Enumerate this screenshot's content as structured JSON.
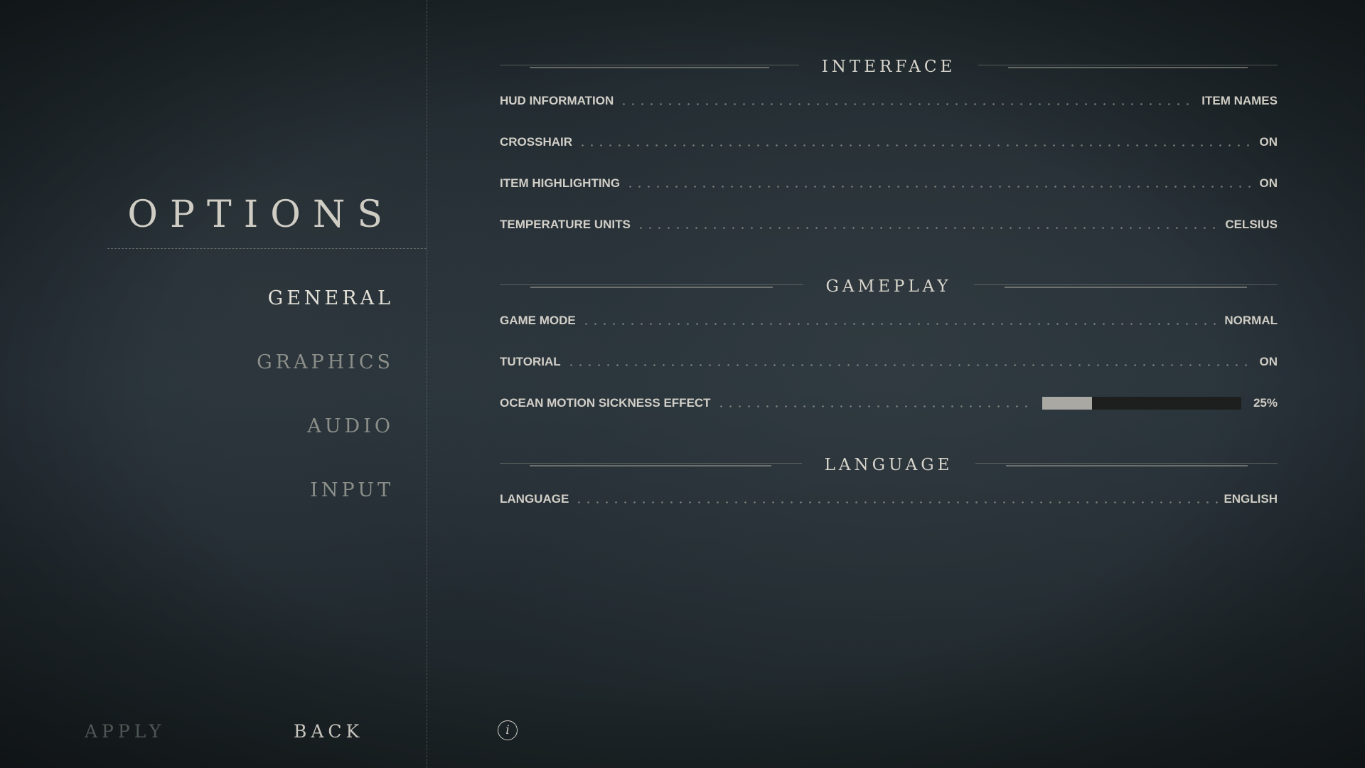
{
  "menu": {
    "title": "OPTIONS",
    "items": [
      {
        "label": "GENERAL",
        "active": true
      },
      {
        "label": "GRAPHICS",
        "active": false
      },
      {
        "label": "AUDIO",
        "active": false
      },
      {
        "label": "INPUT",
        "active": false
      }
    ],
    "apply_label": "APPLY",
    "back_label": "BACK"
  },
  "sections": {
    "interface": {
      "title": "INTERFACE",
      "rows": [
        {
          "label": "HUD INFORMATION",
          "value": "ITEM NAMES"
        },
        {
          "label": "CROSSHAIR",
          "value": "ON"
        },
        {
          "label": "ITEM HIGHLIGHTING",
          "value": "ON"
        },
        {
          "label": "TEMPERATURE UNITS",
          "value": "CELSIUS"
        }
      ]
    },
    "gameplay": {
      "title": "GAMEPLAY",
      "rows": [
        {
          "label": "GAME MODE",
          "value": "NORMAL"
        },
        {
          "label": "TUTORIAL",
          "value": "ON"
        },
        {
          "label": "OCEAN MOTION SICKNESS EFFECT",
          "value": "25%",
          "slider_fraction": 0.25
        }
      ]
    },
    "language": {
      "title": "LANGUAGE",
      "rows": [
        {
          "label": "LANGUAGE",
          "value": "ENGLISH"
        }
      ]
    }
  },
  "info_button": {
    "icon": "info-icon",
    "glyph": "i"
  },
  "colors": {
    "background": "#212a2e",
    "text_active": "#e3e0d8",
    "text_inactive": "#8c8e89",
    "slider_fill": "#a9a8a2",
    "slider_track": "#1c1f1d"
  }
}
